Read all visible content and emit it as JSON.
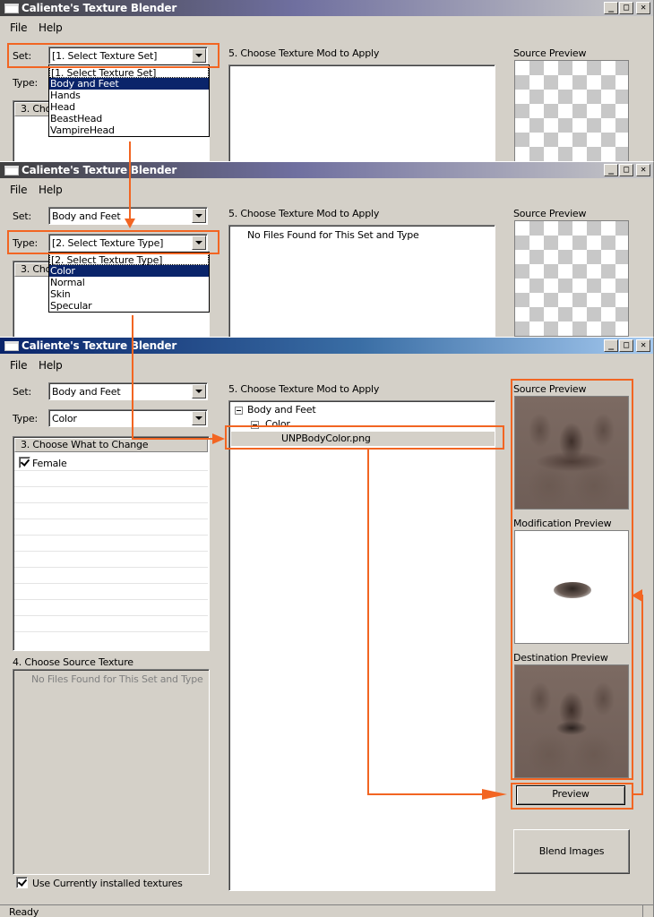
{
  "window": {
    "title": "Caliente's Texture Blender",
    "min_glyph": "_",
    "max_glyph": "□",
    "close_glyph": "✕"
  },
  "menu": {
    "file": "File",
    "help": "Help"
  },
  "labels": {
    "set": "Set:",
    "type": "Type:",
    "choose_mod": "5. Choose Texture Mod to Apply",
    "source_preview": "Source Preview",
    "modification_preview": "Modification Preview",
    "destination_preview": "Destination Preview",
    "choose_what": "3. Choose What to Change",
    "choose_what_clipped": "3. Cho",
    "choose_source": "4. Choose Source Texture",
    "no_files": "No Files Found for This Set and Type",
    "use_installed": "Use Currently installed textures"
  },
  "step1": {
    "set_value": "[1. Select Texture Set]",
    "options": [
      "[1. Select Texture Set]",
      "Body and Feet",
      "Hands",
      "Head",
      "BeastHead",
      "VampireHead"
    ],
    "selected_index": 1
  },
  "step2": {
    "set_value": "Body and Feet",
    "type_value": "[2. Select Texture Type]",
    "options": [
      "[2. Select Texture Type]",
      "Color",
      "Normal",
      "Skin",
      "Specular"
    ],
    "selected_index": 1
  },
  "step3": {
    "set_value": "Body and Feet",
    "type_value": "Color",
    "what_items": [
      {
        "label": "Female",
        "checked": true
      }
    ],
    "tree": {
      "root": "Body and Feet",
      "child": "Color",
      "file": "UNPBodyColor.png"
    },
    "use_installed_checked": true
  },
  "buttons": {
    "preview": "Preview",
    "blend": "Blend Images"
  },
  "status": {
    "text": "Ready"
  },
  "colors": {
    "highlight": "#f26522",
    "selection": "#0a246a",
    "face": "#d4d0c8"
  }
}
